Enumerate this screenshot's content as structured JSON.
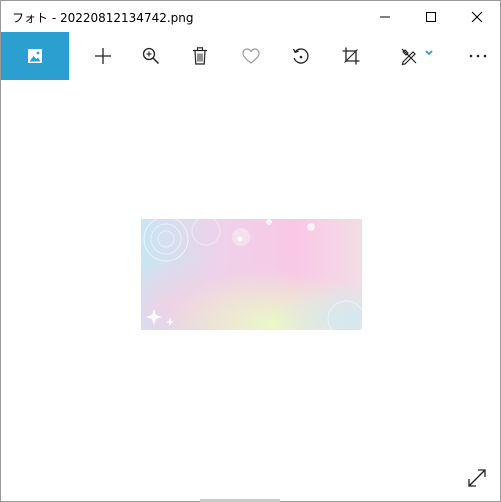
{
  "window": {
    "title": "フォト - 20220812134742.png"
  },
  "caption_buttons": {
    "minimize": "minimize-icon",
    "maximize": "maximize-icon",
    "close": "close-icon"
  },
  "toolbar": {
    "home_icon": "image-icon",
    "add_icon": "plus-icon",
    "zoom_icon": "zoom-in-icon",
    "delete_icon": "trash-icon",
    "favorite_icon": "heart-icon",
    "rotate_icon": "rotate-icon",
    "crop_icon": "crop-icon",
    "edit_icon": "edit-create-icon",
    "more_icon": "more-icon",
    "accent_color": "#2a9fd0"
  },
  "canvas": {
    "photo_description_colors": [
      "#bfe3f2",
      "#f7c6e6",
      "#e9f7c6"
    ],
    "fullscreen_icon": "expand-icon"
  }
}
